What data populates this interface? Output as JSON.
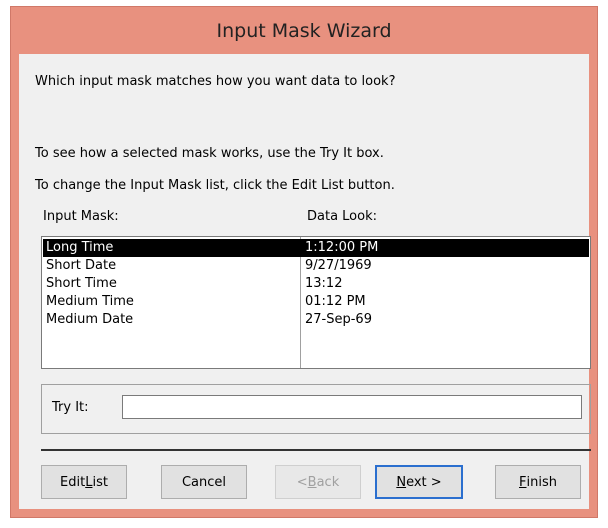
{
  "window": {
    "title": "Input Mask Wizard"
  },
  "prompt": {
    "question": "Which input mask matches how you want data to look?",
    "try_hint": "To see how a selected mask works, use the Try It box.",
    "edit_hint": "To change the Input Mask list, click the Edit List button."
  },
  "list": {
    "col1_header": "Input Mask:",
    "col2_header": "Data Look:",
    "rows": [
      {
        "mask": "Long Time",
        "look": "1:12:00 PM",
        "selected": true
      },
      {
        "mask": "Short Date",
        "look": "9/27/1969",
        "selected": false
      },
      {
        "mask": "Short Time",
        "look": "13:12",
        "selected": false
      },
      {
        "mask": "Medium Time",
        "look": "01:12 PM",
        "selected": false
      },
      {
        "mask": "Medium Date",
        "look": "27-Sep-69",
        "selected": false
      }
    ]
  },
  "tryit": {
    "label": "Try It:",
    "value": ""
  },
  "buttons": {
    "edit_list": {
      "pre": "Edit ",
      "accel": "L",
      "post": "ist"
    },
    "cancel": "Cancel",
    "back": {
      "pre": "< ",
      "accel": "B",
      "post": "ack"
    },
    "next": {
      "pre": "",
      "accel": "N",
      "post": "ext >"
    },
    "finish": {
      "pre": "",
      "accel": "F",
      "post": "inish"
    }
  },
  "colors": {
    "title_bar": "#e8917f",
    "client": "#f0f0f0",
    "selection": "#000000",
    "default_button_border": "#2b6fcf"
  }
}
